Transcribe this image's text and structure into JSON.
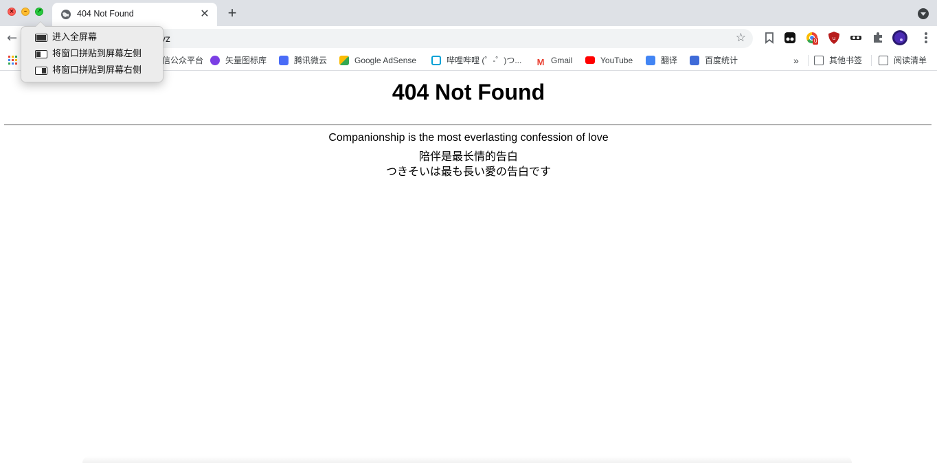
{
  "tab": {
    "title": "404 Not Found",
    "close": "✕"
  },
  "new_tab_label": "+",
  "omnibox": {
    "url_visible": "yz"
  },
  "bookmarks": [
    {
      "label": "信公众平台",
      "icon": "wechat-icon"
    },
    {
      "label": "矢量图标库",
      "icon": "iconfont-icon"
    },
    {
      "label": "腾讯微云",
      "icon": "weiyun-icon"
    },
    {
      "label": "Google AdSense",
      "icon": "adsense-icon"
    },
    {
      "label": "哔哩哔哩 (゜-゜)つ...",
      "icon": "bilibili-icon"
    },
    {
      "label": "Gmail",
      "icon": "gmail-icon"
    },
    {
      "label": "YouTube",
      "icon": "youtube-icon"
    },
    {
      "label": "翻译",
      "icon": "translate-icon"
    },
    {
      "label": "百度统计",
      "icon": "baidu-tongji-icon"
    }
  ],
  "bookmarks_overflow": "»",
  "other_bookmarks": "其他书签",
  "reading_list": "阅读清单",
  "extension_badge": "0",
  "popover": {
    "items": [
      {
        "label": "进入全屏幕",
        "icon": "fullscreen-icon"
      },
      {
        "label": "将窗口拼贴到屏幕左侧",
        "icon": "tile-left-icon"
      },
      {
        "label": "将窗口拼贴到屏幕右侧",
        "icon": "tile-right-icon"
      }
    ]
  },
  "page": {
    "heading": "404 Not Found",
    "lines": [
      "Companionship is the most everlasting confession of love",
      "陪伴是最长情的告白",
      "つきそいは最も長い愛の告白です"
    ]
  },
  "colors": {
    "tabstrip": "#dee1e6",
    "omnibox": "#f1f3f4",
    "popover": "#ececec",
    "close": "#ff5f57",
    "minimize": "#febc2e",
    "maximize": "#28c840"
  }
}
